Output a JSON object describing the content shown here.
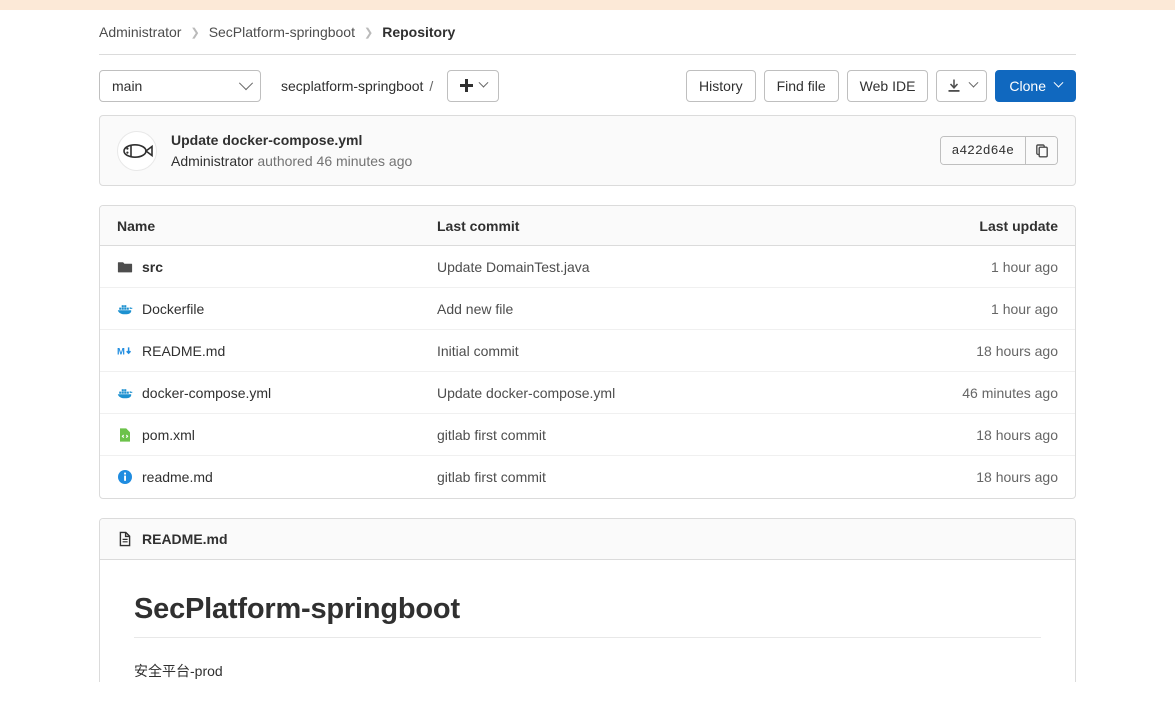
{
  "breadcrumb": [
    {
      "label": "Administrator",
      "current": false
    },
    {
      "label": "SecPlatform-springboot",
      "current": false
    },
    {
      "label": "Repository",
      "current": true
    }
  ],
  "toolbar": {
    "branch": "main",
    "repo_path": "secplatform-springboot",
    "path_separator": "/",
    "add_label": "+",
    "history_label": "History",
    "find_file_label": "Find file",
    "web_ide_label": "Web IDE",
    "download_label": "download-icon",
    "clone_label": "Clone"
  },
  "commit": {
    "title": "Update docker-compose.yml",
    "author": "Administrator",
    "authored_text": "authored",
    "time": "46 minutes ago",
    "sha": "a422d64e",
    "copy_label": "copy-icon"
  },
  "files": {
    "columns": {
      "name": "Name",
      "last_commit": "Last commit",
      "last_update": "Last update"
    },
    "rows": [
      {
        "icon": "folder-icon",
        "name": "src",
        "commit": "Update DomainTest.java",
        "update": "1 hour ago"
      },
      {
        "icon": "docker-icon",
        "name": "Dockerfile",
        "commit": "Add new file",
        "update": "1 hour ago"
      },
      {
        "icon": "markdown-icon",
        "name": "README.md",
        "commit": "Initial commit",
        "update": "18 hours ago"
      },
      {
        "icon": "docker-icon",
        "name": "docker-compose.yml",
        "commit": "Update docker-compose.yml",
        "update": "46 minutes ago"
      },
      {
        "icon": "xml-icon",
        "name": "pom.xml",
        "commit": "gitlab first commit",
        "update": "18 hours ago"
      },
      {
        "icon": "info-icon",
        "name": "readme.md",
        "commit": "gitlab first commit",
        "update": "18 hours ago"
      }
    ]
  },
  "readme": {
    "filename": "README.md",
    "heading": "SecPlatform-springboot",
    "body": "安全平台-prod"
  },
  "colors": {
    "primary": "#1068bf",
    "banner": "#fce9d7",
    "docker_blue": "#1d91d0",
    "markdown_blue": "#1f8ce0",
    "xml_green": "#6cc24a",
    "info_blue": "#1f8ce0"
  }
}
